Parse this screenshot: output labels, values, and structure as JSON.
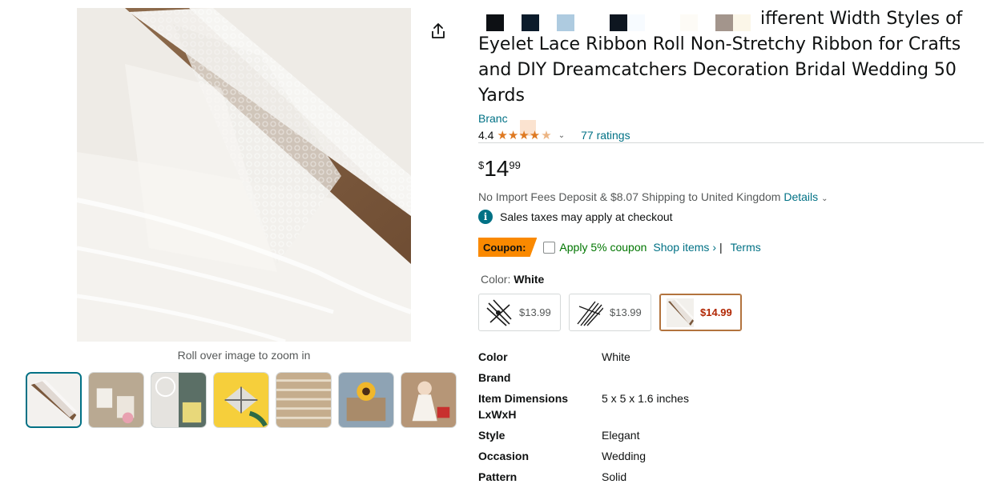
{
  "gallery": {
    "zoom_hint": "Roll over image to zoom in",
    "share_icon": "share-icon",
    "thumbnails": [
      {
        "name": "thumb-lace-roll",
        "selected": true
      },
      {
        "name": "thumb-lace-packaging",
        "selected": false
      },
      {
        "name": "thumb-dreamcatcher",
        "selected": false
      },
      {
        "name": "thumb-gift-box",
        "selected": false
      },
      {
        "name": "thumb-lace-samples",
        "selected": false
      },
      {
        "name": "thumb-sunflower-jars",
        "selected": false
      },
      {
        "name": "thumb-doll-dress",
        "selected": false
      }
    ]
  },
  "product": {
    "title_line1": "ifferent Width Styles of",
    "title_rest": "Eyelet Lace Ribbon Roll Non-Stretchy Ribbon for Crafts and DIY Dreamcatchers Decoration Bridal Wedding 50 Yards",
    "brand_link": "Branc",
    "rating": "4.4",
    "ratings_count": "77 ratings",
    "price": {
      "symbol": "$",
      "whole": "14",
      "fraction": "99"
    },
    "shipping_text": "No Import Fees Deposit & $8.07 Shipping to United Kingdom ",
    "shipping_details": "Details",
    "tax_text": "Sales taxes may apply at checkout",
    "coupon": {
      "badge": "Coupon:",
      "apply_text": "Apply 5% coupon",
      "shop_items": "Shop items ›",
      "separator": "|",
      "terms": "Terms"
    },
    "color_label": "Color: ",
    "color_value": "White",
    "swatches": [
      {
        "price": "$13.99",
        "selected": false
      },
      {
        "price": "$13.99",
        "selected": false
      },
      {
        "price": "$14.99",
        "selected": true
      }
    ],
    "specs": [
      {
        "key": "Color",
        "value": "White"
      },
      {
        "key": "Brand",
        "value": ""
      },
      {
        "key": "Item Dimensions LxWxH",
        "value": "5 x 5 x 1.6 inches"
      },
      {
        "key": "Style",
        "value": "Elegant"
      },
      {
        "key": "Occasion",
        "value": "Wedding"
      },
      {
        "key": "Pattern",
        "value": "Solid"
      }
    ]
  },
  "colors": {
    "link": "#007185",
    "star": "#de7921",
    "coupon_badge": "#fa8900",
    "coupon_green": "#007600",
    "price_red": "#b12704",
    "selected_thumb": "#007185"
  }
}
